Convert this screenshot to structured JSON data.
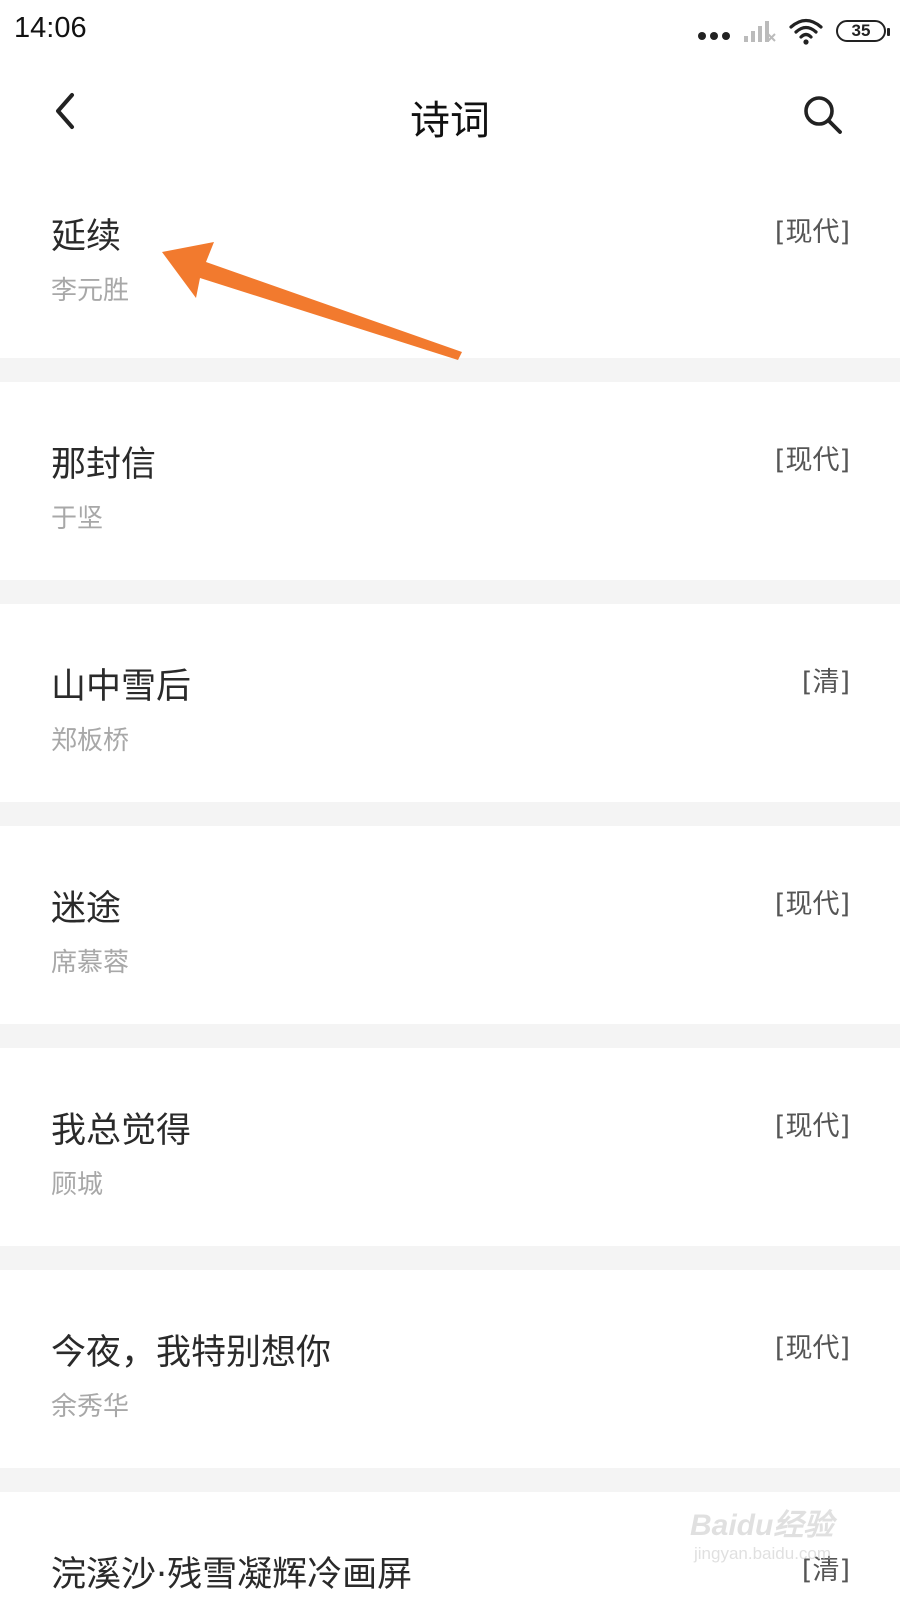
{
  "status_bar": {
    "time": "14:06",
    "battery": "35",
    "icons": [
      "more-dots-icon",
      "signal-icon",
      "wifi-icon",
      "battery-icon"
    ]
  },
  "header": {
    "title": "诗词",
    "back_icon": "chevron-left-icon",
    "search_icon": "search-icon"
  },
  "poems": [
    {
      "title": "延续",
      "author": "李元胜",
      "era": "[现代]"
    },
    {
      "title": "那封信",
      "author": "于坚",
      "era": "[现代]"
    },
    {
      "title": "山中雪后",
      "author": "郑板桥",
      "era": "[清]"
    },
    {
      "title": "迷途",
      "author": "席慕蓉",
      "era": "[现代]"
    },
    {
      "title": "我总觉得",
      "author": "顾城",
      "era": "[现代]"
    },
    {
      "title": "今夜，我特别想你",
      "author": "余秀华",
      "era": "[现代]"
    },
    {
      "title": "浣溪沙·残雪凝辉冷画屏",
      "author": "",
      "era": "[清]"
    }
  ],
  "annotation": {
    "arrow_color": "#f27a2e"
  },
  "watermark": {
    "main": "Baidu经验",
    "sub": "jingyan.baidu.com"
  },
  "colors": {
    "background": "#f4f4f4",
    "card": "#ffffff",
    "author_text": "#a8a8a8"
  }
}
